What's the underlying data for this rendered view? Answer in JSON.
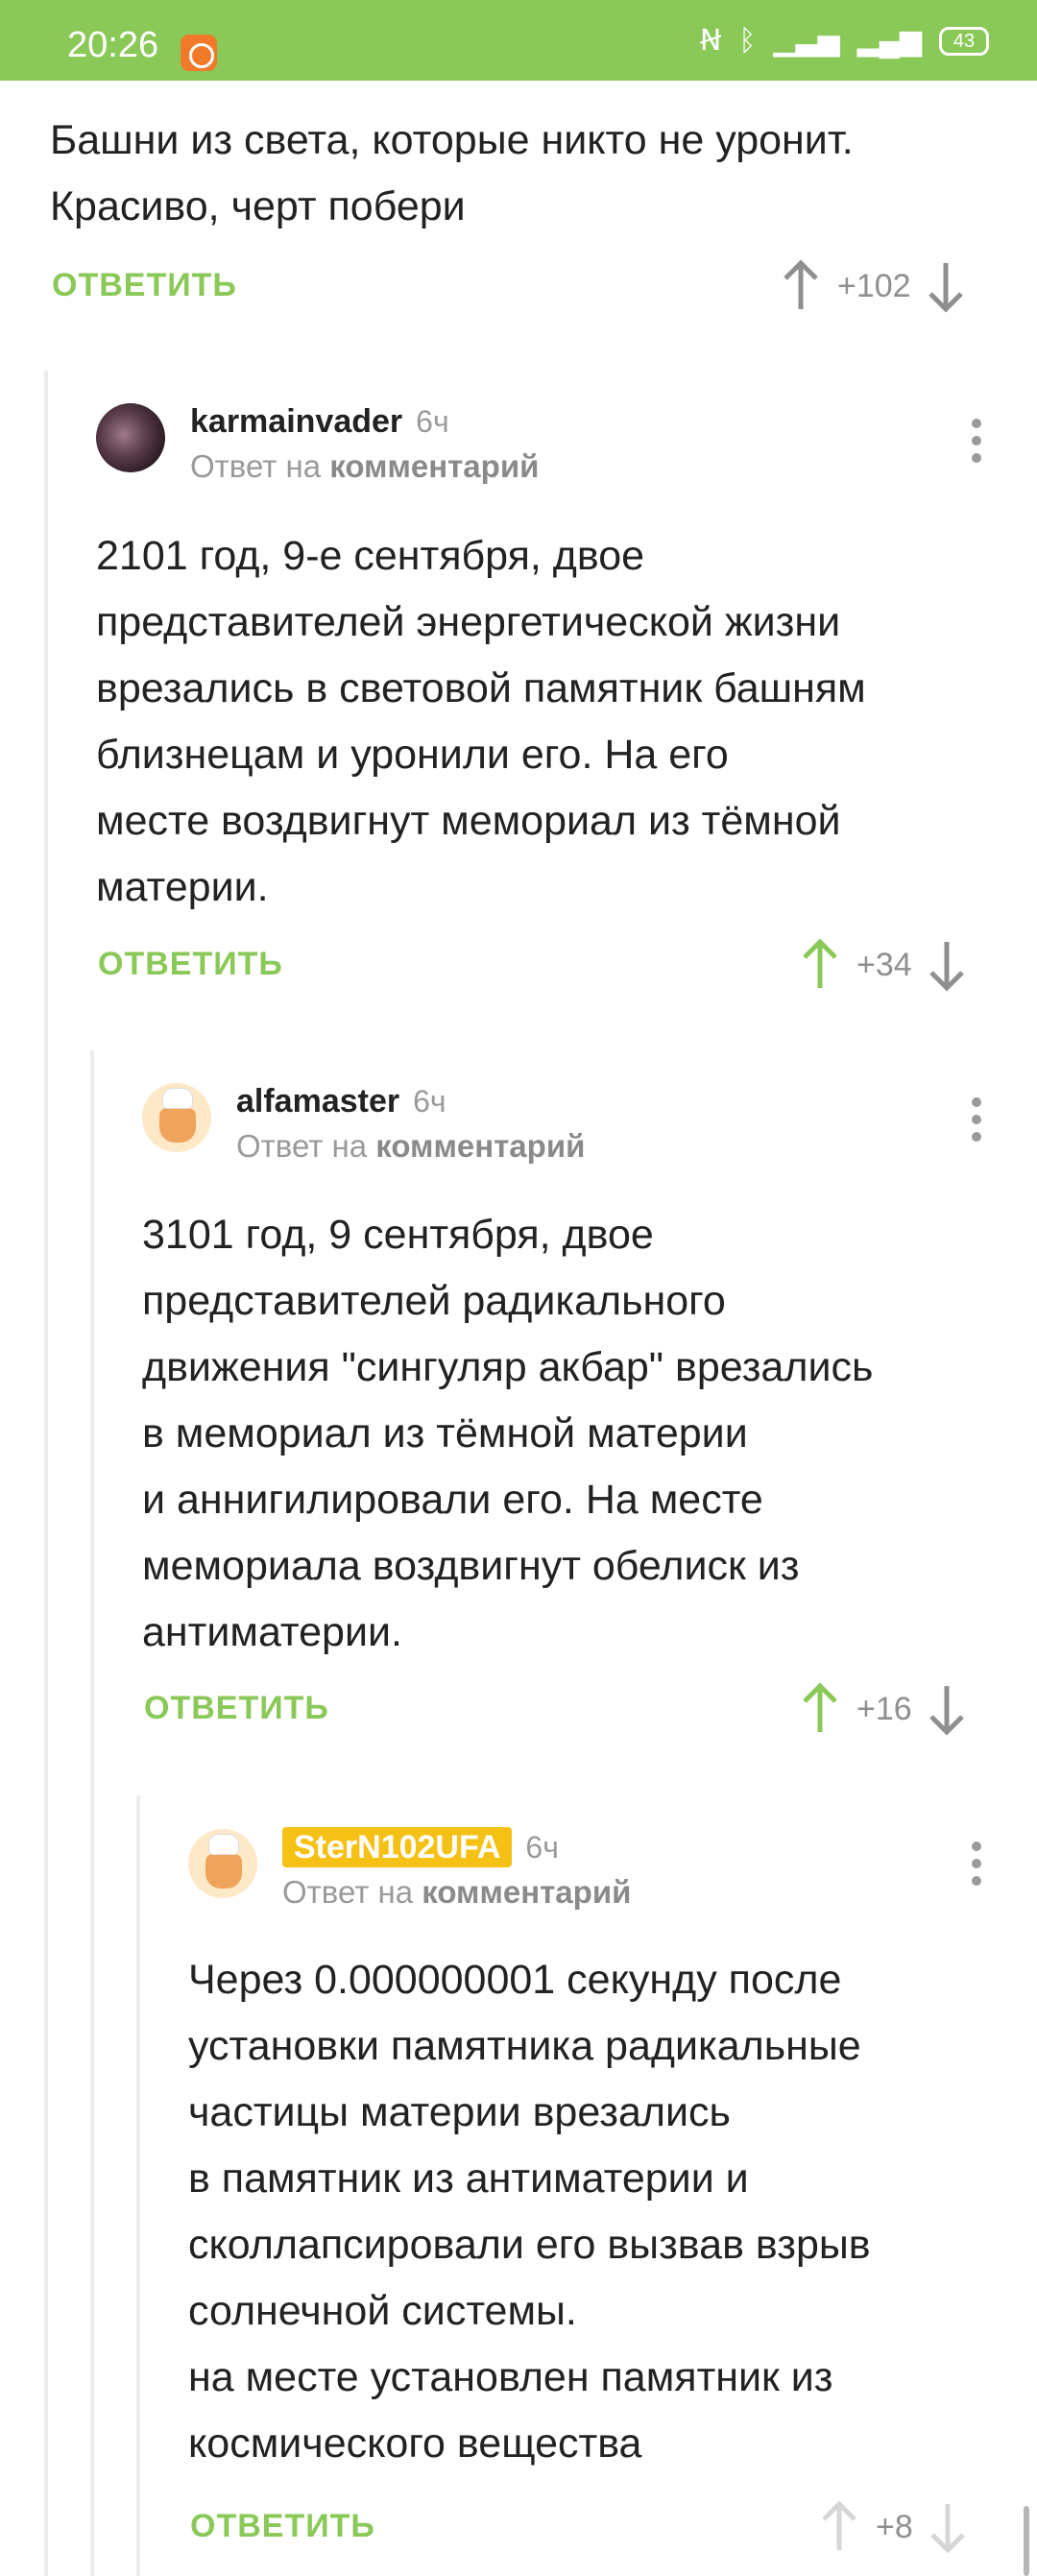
{
  "status_bar": {
    "time": "20:26",
    "battery": "43",
    "icons": [
      "nfc-icon",
      "bluetooth-icon",
      "signal-r-icon",
      "signal-hplus-icon",
      "battery-icon"
    ]
  },
  "colors": {
    "accent": "#8ac858",
    "upvote_active": "#8ac858",
    "vote_inactive": "#8f8f8f",
    "username_badge": "#f5c115"
  },
  "reply_label": "ОТВЕТИТЬ",
  "comments": [
    {
      "text_lines": [
        "Башни из света, которые никто не уронит.",
        "Красиво, черт побери"
      ],
      "score": "+102",
      "upvoted": false
    },
    {
      "username": "karmainvader",
      "ago": "6ч",
      "reply_prefix": "Ответ на",
      "reply_target": "комментарий",
      "text_lines": [
        "2101 год, 9-е сентября, двое",
        "представителей энергетической жизни",
        "врезались в световой памятник башням",
        "близнецам и уронили его. На его",
        "месте воздвигнут мемориал из тёмной",
        "материи."
      ],
      "score": "+34",
      "upvoted": true
    },
    {
      "username": "alfamaster",
      "ago": "6ч",
      "reply_prefix": "Ответ на",
      "reply_target": "комментарий",
      "text_lines": [
        "3101 год, 9 сентября, двое",
        "представителей радикального",
        "движения \"сингуляр акбар\" врезались",
        "в мемориал из тёмной материи",
        "и аннигилировали его. На месте",
        "мемориала воздвигнут обелиск из",
        "антиматерии."
      ],
      "score": "+16",
      "upvoted": true
    },
    {
      "username": "SterN102UFA",
      "ago": "6ч",
      "reply_prefix": "Ответ на",
      "reply_target": "комментарий",
      "text_lines": [
        "Через 0.000000001 секунду после",
        "установки памятника радикальные",
        "частицы материи врезались",
        "в памятник из антиматерии и",
        "сколлапсировали его вызвав взрыв",
        "солнечной системы.",
        "на месте установлен памятник из",
        "космического вещества"
      ],
      "score": "+8",
      "upvoted": false
    }
  ]
}
